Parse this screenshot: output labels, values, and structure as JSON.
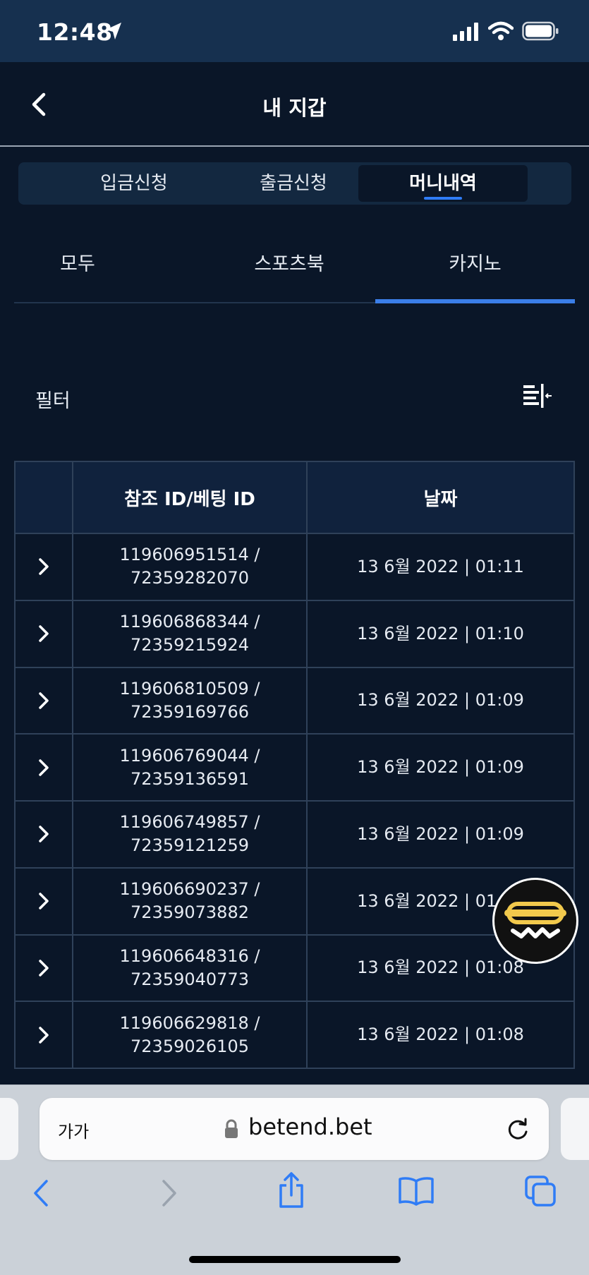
{
  "status_bar": {
    "time": "12:48"
  },
  "header": {
    "title": "내 지갑"
  },
  "main_tabs": [
    {
      "label": "입금신청",
      "active": false
    },
    {
      "label": "출금신청",
      "active": false
    },
    {
      "label": "머니내역",
      "active": true
    }
  ],
  "sub_tabs": [
    {
      "label": "모두",
      "active": false
    },
    {
      "label": "스포츠북",
      "active": false
    },
    {
      "label": "카지노",
      "active": true
    }
  ],
  "filter": {
    "label": "필터"
  },
  "table": {
    "headers": [
      "",
      "참조 ID/베팅 ID",
      "날짜"
    ],
    "rows": [
      {
        "ref_id": "119606951514 /",
        "bet_id": "72359282070",
        "date": "13 6월 2022 | 01:11"
      },
      {
        "ref_id": "119606868344 /",
        "bet_id": "72359215924",
        "date": "13 6월 2022 | 01:10"
      },
      {
        "ref_id": "119606810509 /",
        "bet_id": "72359169766",
        "date": "13 6월 2022 | 01:09"
      },
      {
        "ref_id": "119606769044 /",
        "bet_id": "72359136591",
        "date": "13 6월 2022 | 01:09"
      },
      {
        "ref_id": "119606749857 /",
        "bet_id": "72359121259",
        "date": "13 6월 2022 | 01:09"
      },
      {
        "ref_id": "119606690237 /",
        "bet_id": "72359073882",
        "date": "13 6월 2022 | 01:08"
      },
      {
        "ref_id": "119606648316 /",
        "bet_id": "72359040773",
        "date": "13 6월 2022 | 01:08"
      },
      {
        "ref_id": "119606629818 /",
        "bet_id": "72359026105",
        "date": "13 6월 2022 | 01:08"
      }
    ]
  },
  "browser": {
    "text_size_label": "가가",
    "url": "betend.bet"
  },
  "icons": {
    "location": "location-arrow-icon",
    "signal": "cellular-signal-icon",
    "wifi": "wifi-icon",
    "battery": "battery-icon",
    "back": "chevron-left-icon",
    "filter": "filter-collapse-icon",
    "expand": "chevron-right-icon",
    "chat": "chat-widget-icon",
    "lock": "lock-icon",
    "reload": "reload-icon",
    "nav_back": "browser-back-icon",
    "nav_forward": "browser-forward-icon",
    "share": "share-icon",
    "bookmarks": "bookmarks-icon",
    "tabs": "tabs-icon"
  },
  "colors": {
    "background": "#0a1628",
    "status_bar": "#16304f",
    "accent": "#3b7ee8",
    "table_header": "#10223d",
    "table_border": "#2f4159",
    "browser_bar": "#cbd1d8",
    "browser_icon": "#2f7cf6",
    "chat_badge": "#f2c94c"
  }
}
